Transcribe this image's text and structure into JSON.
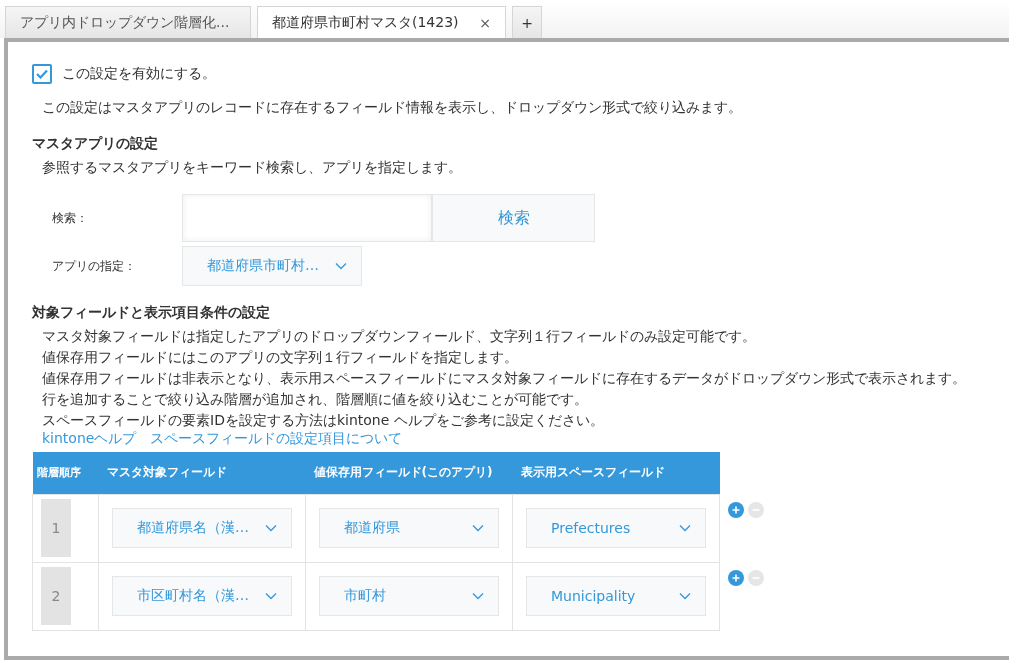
{
  "tabs": [
    {
      "label": "アプリ内ドロップダウン階層化...",
      "selected": false
    },
    {
      "label": "都道府県市町村マスタ(1423)",
      "selected": true,
      "close": "×"
    }
  ],
  "add_tab": "+",
  "enable": {
    "checked": true,
    "label": "この設定を有効にする。"
  },
  "description": "この設定はマスタアプリのレコードに存在するフィールド情報を表示し、ドロップダウン形式で絞り込みます。",
  "master_section": {
    "heading": "マスタアプリの設定",
    "description": "参照するマスタアプリをキーワード検索し、アプリを指定します。",
    "search_label": "検索：",
    "search_button": "検索",
    "app_label": "アプリの指定：",
    "app_value": "都道府県市町村…"
  },
  "field_section": {
    "heading": "対象フィールドと表示項目条件の設定",
    "lines": [
      "マスタ対象フィールドは指定したアプリのドロップダウンフィールド、文字列１行フィールドのみ設定可能です。",
      "値保存用フィールドにはこのアプリの文字列１行フィールドを指定します。",
      "値保存用フィールドは非表示となり、表示用スペースフィールドにマスタ対象フィールドに存在するデータがドロップダウン形式で表示されます。",
      "行を追加することで絞り込み階層が追加され、階層順に値を絞り込むことが可能です。",
      "スペースフィールドの要素IDを設定する方法はkintone ヘルプをご参考に設定ください。"
    ],
    "links": [
      "kintoneヘルプ",
      "スペースフィールドの設定項目について"
    ]
  },
  "table": {
    "columns": [
      "階層順序",
      "マスタ対象フィールド",
      "値保存用フィールド(このアプリ)",
      "表示用スペースフィールド"
    ],
    "rows": [
      {
        "order": "1",
        "master_field": "都道府県名（漢…",
        "value_field": "都道府県",
        "space_field": "Prefectures",
        "remove_enabled": false
      },
      {
        "order": "2",
        "master_field": "市区町村名（漢…",
        "value_field": "市町村",
        "space_field": "Municipality",
        "remove_enabled": false
      }
    ]
  }
}
